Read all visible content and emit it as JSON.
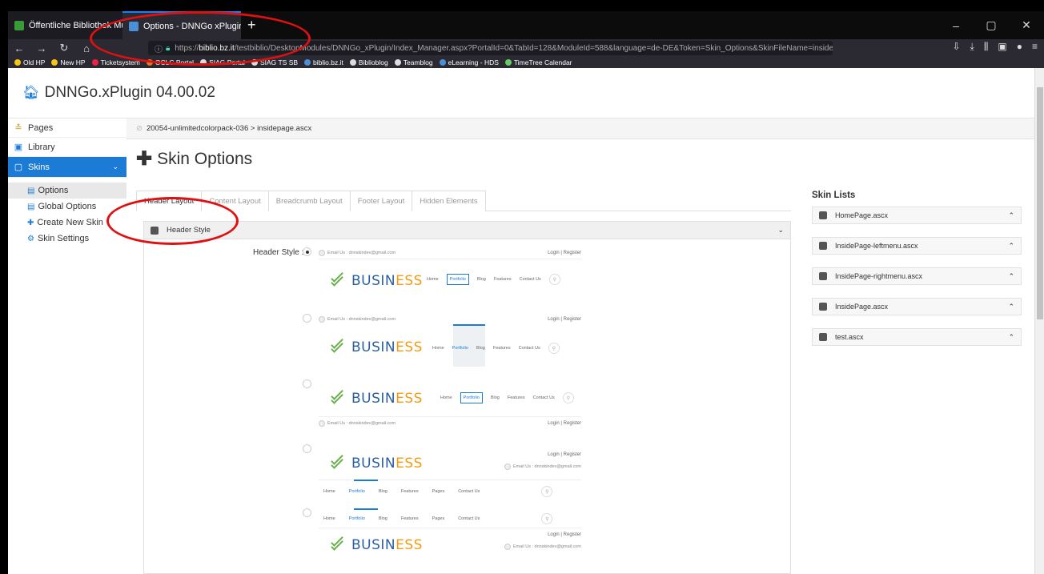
{
  "browser": {
    "tabs": [
      {
        "label": "Öffentliche Bibliothek Musterh",
        "favicon_color": "#3a9a3a"
      },
      {
        "label": "Options - DNNGo xPlugin - xP",
        "favicon_color": "#4a90d9"
      }
    ],
    "new_tab": "+",
    "window_controls": [
      "–",
      "▢",
      "✕"
    ],
    "url_prefix": "https://",
    "url_host": "biblio.bz.it",
    "url_path": "/testbiblio/DesktopModules/DNNGo_xPlugin/Index_Manager.aspx?PortalId=0&TabId=128&ModuleId=588&language=de-DE&Token=Skin_Options&SkinFileName=insidepage",
    "url_right": "··· ♡ ☆",
    "bookmarks": [
      {
        "label": "Old HP",
        "color": "#f5c518"
      },
      {
        "label": "New HP",
        "color": "#f5c518"
      },
      {
        "label": "Ticketsystem",
        "color": "#e24"
      },
      {
        "label": "OCLC Portal",
        "color": "#e87722"
      },
      {
        "label": "SIAG Portal",
        "color": "#ddd"
      },
      {
        "label": "SIAG TS SB",
        "color": "#ddd"
      },
      {
        "label": "biblio.bz.it",
        "color": "#4a90d9"
      },
      {
        "label": "Biblioblog",
        "color": "#ddd"
      },
      {
        "label": "Teamblog",
        "color": "#ddd"
      },
      {
        "label": "eLearning - HDS",
        "color": "#4a90d9"
      },
      {
        "label": "TimeTree Calendar",
        "color": "#6c6"
      }
    ]
  },
  "app": {
    "title": "DNNGo.xPlugin 04.00.02",
    "accent": "#1c7cd5"
  },
  "sidebar": {
    "items": [
      {
        "label": "Pages",
        "icon": "stack-icon"
      },
      {
        "label": "Library",
        "icon": "image-icon"
      },
      {
        "label": "Skins",
        "icon": "skins-icon"
      }
    ],
    "subitems": [
      {
        "label": "Options",
        "icon": "doc-icon"
      },
      {
        "label": "Global Options",
        "icon": "doc-icon"
      },
      {
        "label": "Create New Skin",
        "icon": "plus-icon"
      },
      {
        "label": "Skin Settings",
        "icon": "gear-icon"
      }
    ]
  },
  "breadcrumb": "20054-unlimitedcolorpack-036 > insidepage.ascx",
  "page_title": "Skin Options",
  "tabs": [
    "Header Layout",
    "Content Layout",
    "Breadcrumb Layout",
    "Footer Layout",
    "Hidden Elements"
  ],
  "panel": {
    "title": "Header Style",
    "field_label": "Header Style :"
  },
  "preview": {
    "email": "Email Us : dnnskindev@gmail.com",
    "login": "Login  |  Register",
    "logo_a": "BUSIN",
    "logo_b": "ESS",
    "menu_short": [
      "Home",
      "Portfolio",
      "Blog",
      "Features",
      "Contact Us"
    ],
    "menu_long": [
      "Home",
      "Portfolio",
      "Blog",
      "Features",
      "Pages",
      "Contact Us"
    ]
  },
  "skin_lists": {
    "title": "Skin Lists",
    "items": [
      "HomePage.ascx",
      "InsidePage-leftmenu.ascx",
      "InsidePage-rightmenu.ascx",
      "InsidePage.ascx",
      "test.ascx"
    ]
  }
}
